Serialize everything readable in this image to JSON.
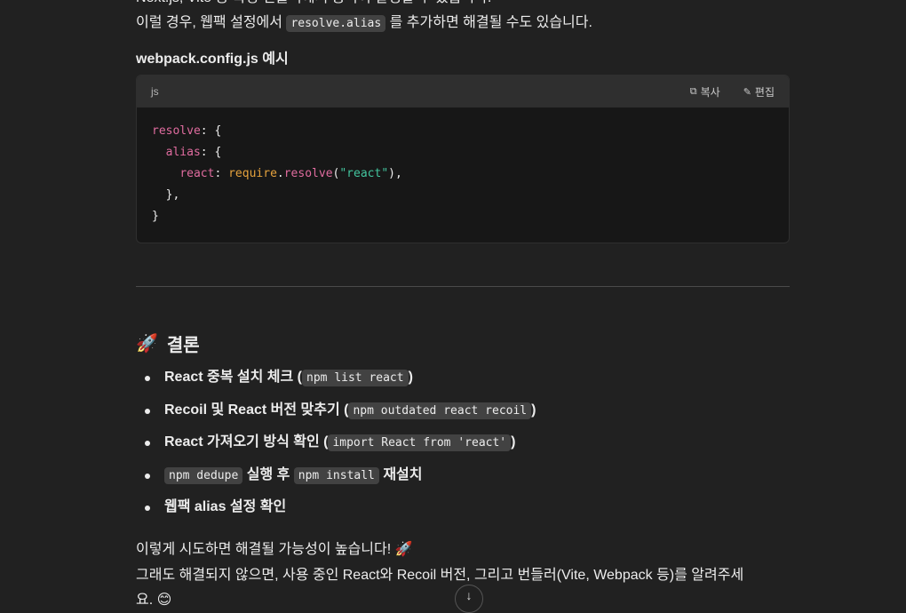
{
  "top_cut_line": "Next.js, Vite 등 특정 번들러에서 중복이 발생할 수 있습니다.",
  "alias_sentence": {
    "before": "이럴 경우, 웹팩 설정에서 ",
    "code": "resolve.alias",
    "after": " 를 추가하면 해결될 수도 있습니다."
  },
  "example_title": "webpack.config.js 예시",
  "code_block": {
    "lang": "js",
    "copy_label": "복사",
    "edit_label": "편집",
    "lines": {
      "l1_key": "resolve",
      "l1_rest": ": {",
      "l2_key": "alias",
      "l2_rest": ": {",
      "l3_key": "react",
      "l3_colon": ": ",
      "l3_fn": "require",
      "l3_dot": ".",
      "l3_method": "resolve",
      "l3_open": "(",
      "l3_str": "\"react\"",
      "l3_close": "),",
      "l4": "},",
      "l5": "}"
    }
  },
  "conclusion": {
    "icon": "🚀",
    "title": "결론",
    "items": [
      {
        "text": "React 중복 설치 체크 (",
        "code": "npm list react",
        "end": ")"
      },
      {
        "text": "Recoil 및 React 버전 맞추기 (",
        "code": "npm outdated react recoil",
        "end": ")"
      },
      {
        "text": "React 가져오기 방식 확인 (",
        "code": "import React from 'react'",
        "end": ")"
      },
      {
        "code1": "npm dedupe",
        "mid": " 실행 후 ",
        "code2": "npm install",
        "end": " 재설치"
      },
      {
        "text": "웹팩 alias 설정 확인"
      }
    ]
  },
  "closing": {
    "line1": "이렇게 시도하면 해결될 가능성이 높습니다! 🚀",
    "line2": "그래도 해결되지 않으면, 사용 중인 React와 Recoil 버전, 그리고 번들러(Vite, Webpack 등)를 알려주세",
    "line3": "요. 😊"
  },
  "scroll_button": "↓"
}
